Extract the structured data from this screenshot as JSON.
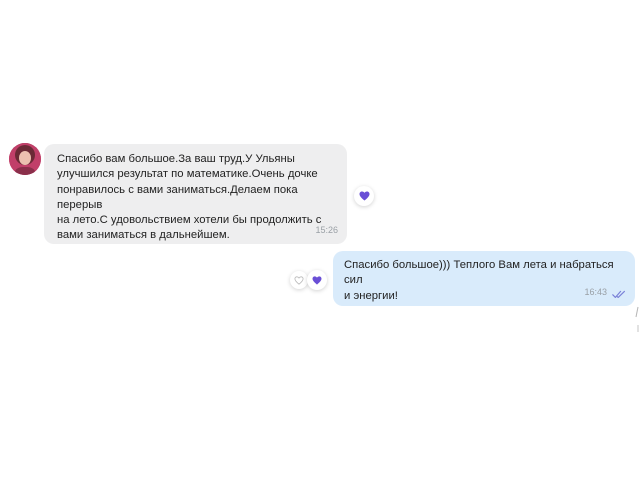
{
  "conversation": {
    "incoming": {
      "text": "Спасибо вам большое.За ваш труд.У Ульяны\nулучшился результат по математике.Очень дочке\nпонравилось с вами заниматься.Делаем пока перерыв\nна лето.С удовольствием хотели бы продолжить с\nвами заниматься в дальнейшем.",
      "time": "15:26",
      "reaction": "purple-heart-icon"
    },
    "outgoing": {
      "text": "Спасибо большое))) Теплого Вам лета и набраться сил\nи энергии!",
      "time": "16:43",
      "status": "read-double-check-icon",
      "reaction": "purple-heart-icon"
    }
  },
  "colors": {
    "incoming_bubble": "#eeeeef",
    "outgoing_bubble": "#d9ebfb",
    "heart": "#6a4fd6",
    "read_ticks": "#7b82d8",
    "timestamp": "#9aa0a6"
  }
}
